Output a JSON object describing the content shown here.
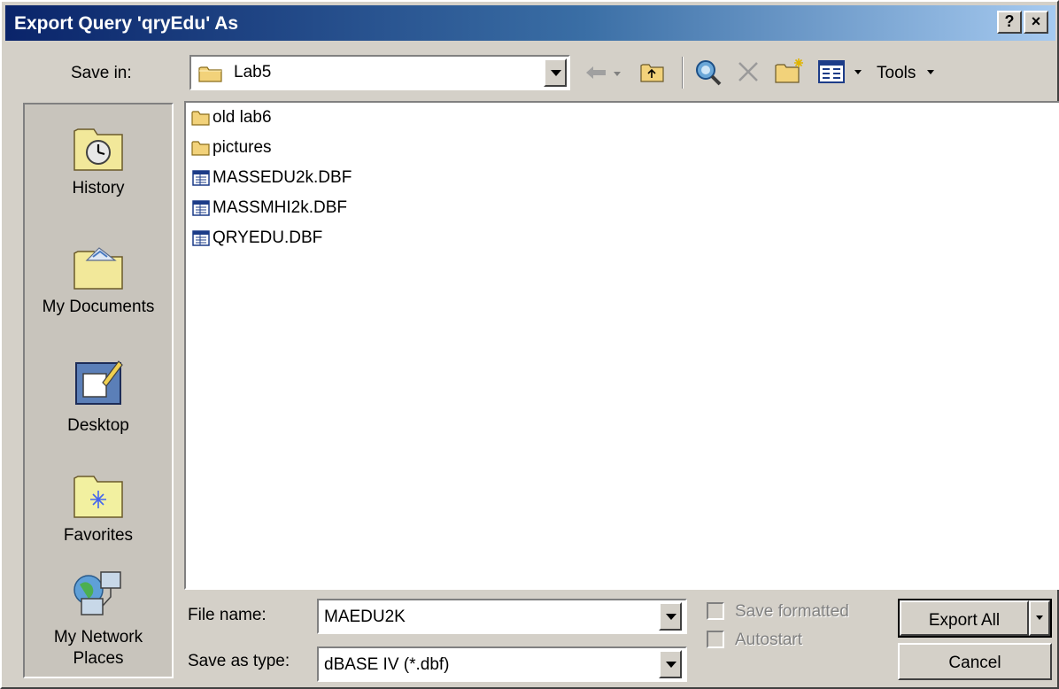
{
  "window": {
    "title": "Export Query 'qryEdu' As",
    "help_label": "?",
    "close_label": "×"
  },
  "save_in": {
    "label": "Save in:",
    "value": "Lab5"
  },
  "toolbar": {
    "back_icon": "back-arrow-icon",
    "up_icon": "up-one-level-icon",
    "search_icon": "search-web-icon",
    "delete_icon": "delete-icon",
    "new_folder_icon": "new-folder-icon",
    "views_icon": "views-icon",
    "tools_label": "Tools"
  },
  "places": [
    {
      "label": "History",
      "icon": "history-icon"
    },
    {
      "label": "My Documents",
      "icon": "my-documents-icon"
    },
    {
      "label": "Desktop",
      "icon": "desktop-icon"
    },
    {
      "label": "Favorites",
      "icon": "favorites-icon"
    },
    {
      "label": "My Network Places",
      "icon": "network-places-icon"
    }
  ],
  "files": [
    {
      "name": "old lab6",
      "type": "folder"
    },
    {
      "name": "pictures",
      "type": "folder"
    },
    {
      "name": "MASSEDU2k.DBF",
      "type": "dbf"
    },
    {
      "name": "MASSMHI2k.DBF",
      "type": "dbf"
    },
    {
      "name": "QRYEDU.DBF",
      "type": "dbf"
    }
  ],
  "file_name": {
    "label": "File name:",
    "value": "MAEDU2K"
  },
  "save_as_type": {
    "label": "Save as type:",
    "value": "dBASE IV (*.dbf)"
  },
  "options": {
    "save_formatted_label": "Save formatted",
    "save_formatted_checked": false,
    "autostart_label": "Autostart",
    "autostart_checked": false
  },
  "buttons": {
    "export_all": "Export All",
    "cancel": "Cancel"
  }
}
